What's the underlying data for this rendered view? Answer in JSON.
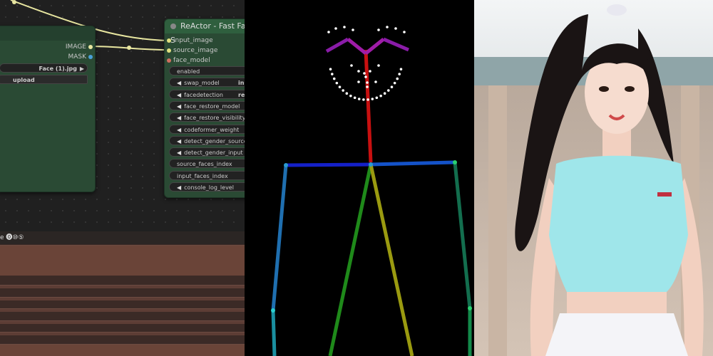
{
  "left_node": {
    "outputs": [
      {
        "label": "IMAGE",
        "color": "#64b5f6"
      },
      {
        "label": "MASK",
        "color": "#81c784"
      }
    ],
    "image_value": "Face (1).jpg",
    "upload_label": "upload"
  },
  "reactor_node": {
    "title": "ReActor - Fast Face S",
    "inputs": [
      {
        "label": "input_image",
        "color": "#e0e080"
      },
      {
        "label": "source_image",
        "color": "#e0e080"
      },
      {
        "label": "face_model",
        "color": "#d07060"
      }
    ],
    "widgets": [
      {
        "label": "enabled",
        "value": "",
        "arrow": false
      },
      {
        "label": "swap_model",
        "value": "ins",
        "arrow": true
      },
      {
        "label": "facedetection",
        "value": "re",
        "arrow": true
      },
      {
        "label": "face_restore_model",
        "value": "",
        "arrow": true
      },
      {
        "label": "face_restore_visibility",
        "value": "",
        "arrow": true
      },
      {
        "label": "codeformer_weight",
        "value": "",
        "arrow": true
      },
      {
        "label": "detect_gender_source",
        "value": "",
        "arrow": true
      },
      {
        "label": "detect_gender_input",
        "value": "",
        "arrow": true
      },
      {
        "label": "source_faces_index",
        "value": "",
        "arrow": false
      },
      {
        "label": "input_faces_index",
        "value": "",
        "arrow": false
      },
      {
        "label": "console_log_level",
        "value": "",
        "arrow": true
      }
    ]
  },
  "bottom_toolbar": {
    "text": "e ⓿⑩⑤"
  },
  "colors": {
    "node_body": "#2a4a34",
    "node_header": "#2f5f3e",
    "wire": "#e8e6a0",
    "pose_blue": "#1a2fd0",
    "pose_red": "#d01010"
  }
}
